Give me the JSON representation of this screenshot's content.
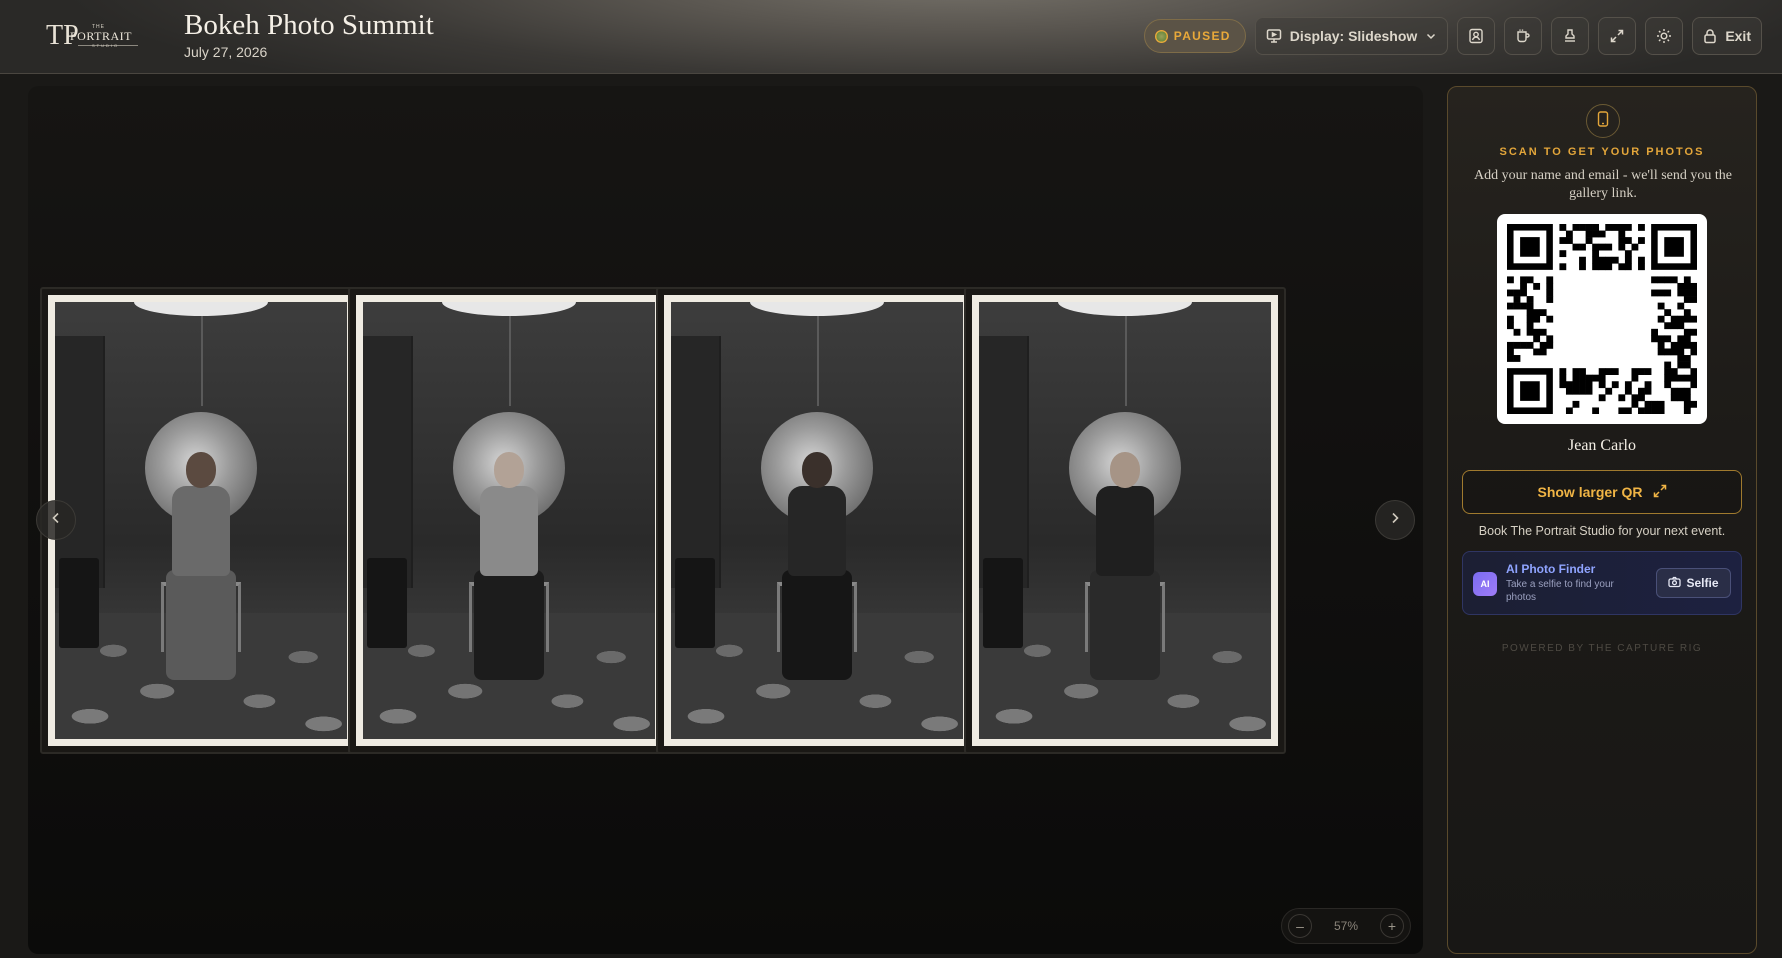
{
  "brand": {
    "logo_monogram": "TP",
    "logo_the": "THE",
    "logo_word": "PORTRAIT",
    "logo_studio": "STUDIO"
  },
  "event": {
    "title": "Bokeh Photo Summit",
    "date": "July 27, 2026"
  },
  "toolbar": {
    "status": "PAUSED",
    "display_label": "Display: Slideshow",
    "exit_label": "Exit",
    "icons": [
      "portrait-icon",
      "drink-icon",
      "stamp-icon",
      "expand-icon",
      "sun-icon",
      "lock-icon"
    ]
  },
  "slideshow": {
    "photos": [
      {
        "label": "Woman seated holding camera",
        "tone_shirt": "#6a6a6a",
        "tone_legs": "#5a5a5a",
        "skin": "#5b4a40"
      },
      {
        "label": "Woman seated smiling with camera",
        "tone_shirt": "#8a8a8a",
        "tone_legs": "#1c1c1c",
        "skin": "#b2a296"
      },
      {
        "label": "Man seated in dark suit",
        "tone_shirt": "#262626",
        "tone_legs": "#161616",
        "skin": "#3a302b"
      },
      {
        "label": "Woman seated raising camera",
        "tone_shirt": "#1f1f1f",
        "tone_legs": "#2a2a2a",
        "skin": "#a69486"
      }
    ],
    "zoom_level": "57%"
  },
  "sidebar": {
    "scan_title": "SCAN TO GET YOUR PHOTOS",
    "scan_desc": "Add your name and email - we'll send you the gallery link.",
    "photographer": "Jean Carlo",
    "larger_qr_label": "Show larger QR",
    "book_text": "Book The Portrait Studio for your next event.",
    "ai_badge": "AI",
    "ai_title": "AI Photo Finder",
    "ai_sub": "Take a selfie to find your photos",
    "selfie_label": "Selfie",
    "powered": "POWERED BY THE CAPTURE RIG"
  },
  "colors": {
    "accent_gold": "#e3a63a",
    "ai_blue": "#8fa4ff"
  }
}
